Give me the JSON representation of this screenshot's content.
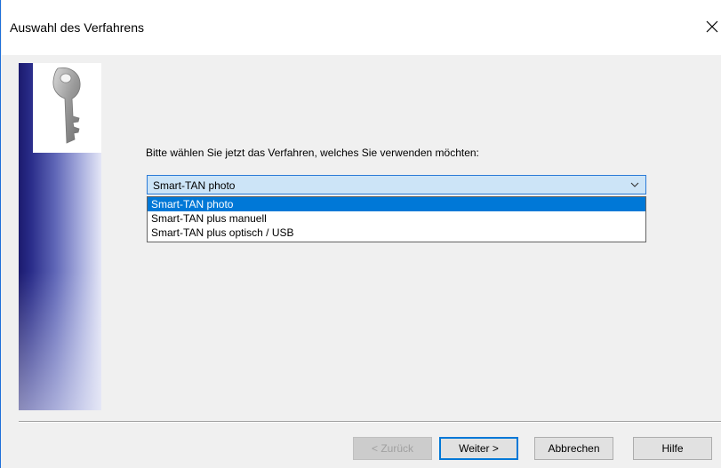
{
  "window": {
    "title": "Auswahl des Verfahrens",
    "close_icon": "close-icon"
  },
  "side_panel": {
    "icon": "key-icon"
  },
  "main": {
    "prompt": "Bitte wählen Sie jetzt das Verfahren, welches Sie verwenden möchten:",
    "combo": {
      "selected": "Smart-TAN photo",
      "arrow_icon": "chevron-down-icon",
      "options": [
        "Smart-TAN photo",
        "Smart-TAN plus manuell",
        "Smart-TAN plus optisch / USB"
      ],
      "highlighted_index": 0
    }
  },
  "buttons": {
    "back": "< Zurück",
    "next": "Weiter >",
    "cancel": "Abbrechen",
    "help": "Hilfe"
  },
  "colors": {
    "accent": "#0078d7",
    "window_border": "#1e6fd9",
    "combo_bg": "#cce4f7"
  }
}
